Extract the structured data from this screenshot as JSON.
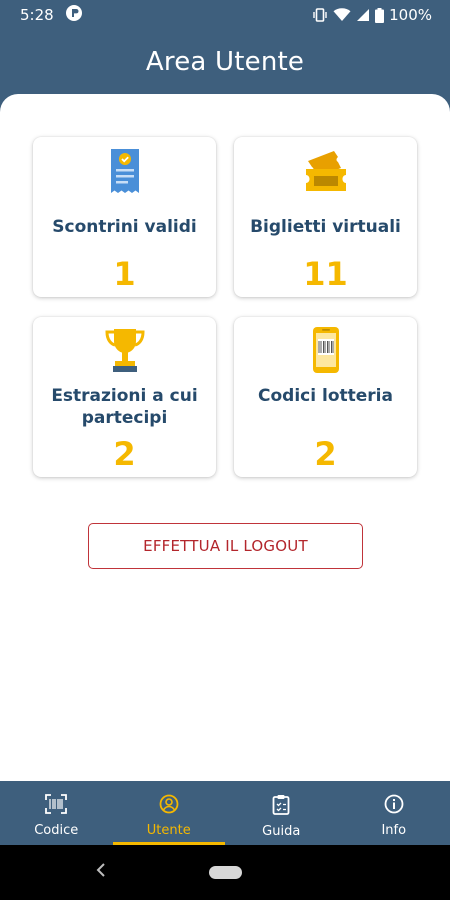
{
  "status_bar": {
    "time": "5:28",
    "battery_percent": "100%"
  },
  "header": {
    "title": "Area Utente"
  },
  "cards": [
    {
      "label": "Scontrini validi",
      "value": "1",
      "icon": "receipt-icon"
    },
    {
      "label": "Biglietti virtuali",
      "value": "11",
      "icon": "tickets-icon"
    },
    {
      "label": "Estrazioni a cui partecipi",
      "value": "2",
      "icon": "trophy-icon"
    },
    {
      "label": "Codici lotteria",
      "value": "2",
      "icon": "phone-barcode-icon"
    }
  ],
  "logout": {
    "label": "EFFETTUA IL LOGOUT"
  },
  "bottom_nav": {
    "active": "Utente",
    "items": [
      {
        "label": "Codice",
        "icon": "barcode-scan-icon"
      },
      {
        "label": "Utente",
        "icon": "user-circle-icon"
      },
      {
        "label": "Guida",
        "icon": "clipboard-icon"
      },
      {
        "label": "Info",
        "icon": "info-icon"
      }
    ]
  },
  "colors": {
    "primary": "#3e5f7d",
    "accent": "#f5b800",
    "label_text": "#264a6b",
    "logout": "#b3262c"
  }
}
